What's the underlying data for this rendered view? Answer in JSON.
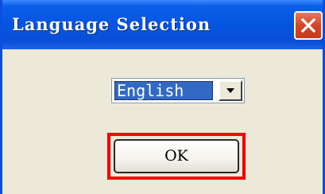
{
  "window": {
    "title": "Language Selection"
  },
  "language_select": {
    "selected": "English"
  },
  "ok_button": {
    "label": "OK"
  },
  "icons": {
    "close": "close-icon",
    "dropdown": "chevron-down-icon"
  },
  "colors": {
    "titlebar": "#0453e0",
    "client_background": "#ece9d8",
    "selection_highlight": "#316ac5",
    "close_button": "#d4462a",
    "focus_outline": "#ff0000"
  }
}
